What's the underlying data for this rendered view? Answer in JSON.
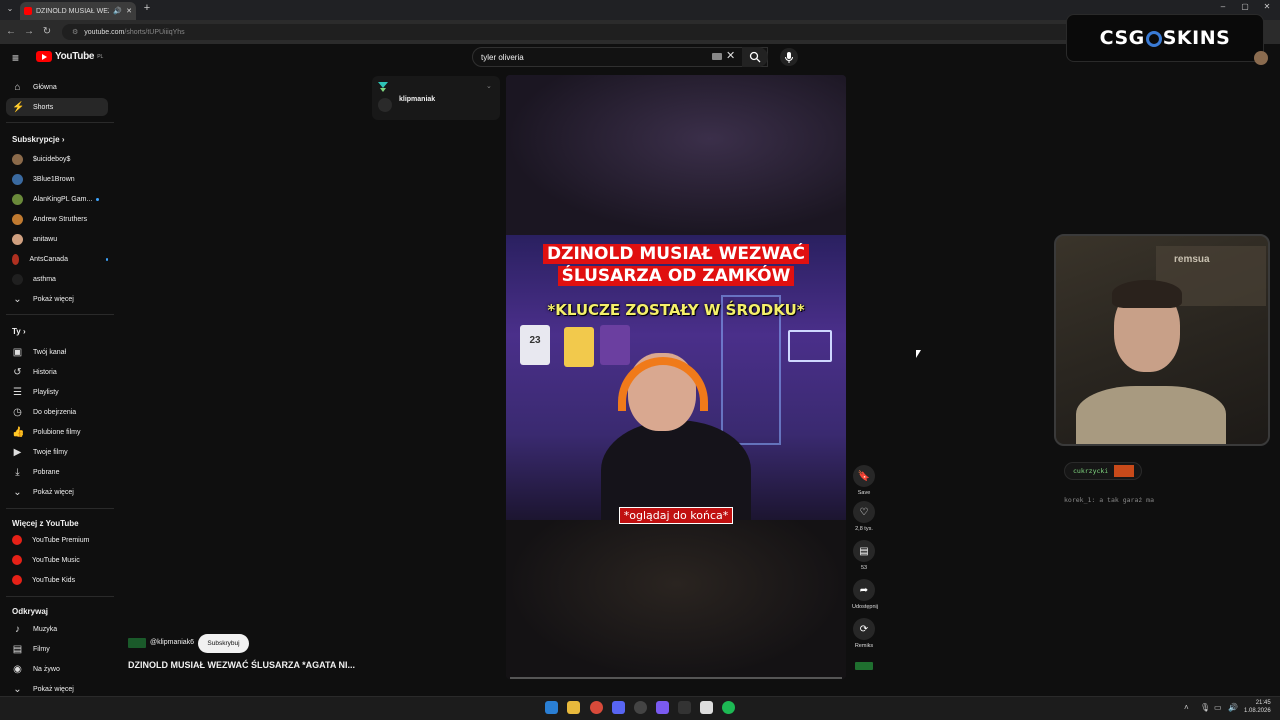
{
  "browser": {
    "tab_title": "DZINOLD MUSIAŁ WEZWA",
    "new_tab": "+",
    "url_host": "youtube.com",
    "url_path": "/shorts/tUPUiiiqYhs"
  },
  "header": {
    "logo_text": "YouTube",
    "region": "PL",
    "search_value": "tyler oliveria"
  },
  "overlay": {
    "brand_left": "CSG",
    "brand_right": "SKINS"
  },
  "sidebar": {
    "main": [
      {
        "label": "Główna",
        "icon": "home-icon"
      },
      {
        "label": "Shorts",
        "icon": "shorts-icon"
      }
    ],
    "subscriptions_title": "Subskrypcje",
    "subscriptions": [
      {
        "label": "$uicideboy$",
        "color": "#8b6a4a",
        "live": false
      },
      {
        "label": "3Blue1Brown",
        "color": "#3a6aa0",
        "live": false
      },
      {
        "label": "AlanKingPL Gam...",
        "color": "#6a8a3a",
        "live": true
      },
      {
        "label": "Andrew Struthers",
        "color": "#c07a30",
        "live": false
      },
      {
        "label": "anitawu",
        "color": "#d0a080",
        "live": false
      },
      {
        "label": "AntsCanada",
        "color": "#b03020",
        "live": true
      },
      {
        "label": "asthma",
        "color": "#202020",
        "live": false
      }
    ],
    "show_more": "Pokaż więcej",
    "you_title": "Ty",
    "you": [
      {
        "label": "Twój kanał",
        "icon": "channel-icon"
      },
      {
        "label": "Historia",
        "icon": "history-icon"
      },
      {
        "label": "Playlisty",
        "icon": "playlist-icon"
      },
      {
        "label": "Do obejrzenia",
        "icon": "watch-later-icon"
      },
      {
        "label": "Polubione filmy",
        "icon": "like-icon"
      },
      {
        "label": "Twoje filmy",
        "icon": "video-icon"
      },
      {
        "label": "Pobrane",
        "icon": "download-icon"
      },
      {
        "label": "Pokaż więcej",
        "icon": "chevron-down-icon"
      }
    ],
    "more_title": "Więcej z YouTube",
    "more": [
      {
        "label": "YouTube Premium"
      },
      {
        "label": "YouTube Music"
      },
      {
        "label": "YouTube Kids"
      }
    ],
    "explore_title": "Odkrywaj",
    "explore": [
      {
        "label": "Muzyka",
        "icon": "music-icon"
      },
      {
        "label": "Filmy",
        "icon": "film-icon"
      },
      {
        "label": "Na żywo",
        "icon": "live-icon"
      },
      {
        "label": "Pokaż więcej",
        "icon": "chevron-down-icon"
      }
    ]
  },
  "channel_card": {
    "name": "klipmaniak"
  },
  "video": {
    "caption_top": "DZINOLD MUSIAŁ WEZWAĆ ŚLUSARZA OD ZAMKÓW",
    "caption_mid": "*KLUCZE ZOSTAŁY W ŚRODKU*",
    "caption_bottom": "*oglądaj do końca*",
    "jersey_number": "23"
  },
  "actions": [
    {
      "label": "Save",
      "icon": "bookmark-icon"
    },
    {
      "label": "2,8 tys.",
      "icon": "heart-icon"
    },
    {
      "label": "53",
      "icon": "comment-icon"
    },
    {
      "label": "Udostępnij",
      "icon": "share-icon"
    },
    {
      "label": "Remiks",
      "icon": "remix-icon"
    }
  ],
  "meta": {
    "handle": "@klipmaniak6",
    "subscribe": "Subskrybuj",
    "title": "DZINOLD MUSIAŁ WEZWAĆ ŚLUSARZA *AGATA NI..."
  },
  "webcam": {
    "wall_text": "remsua"
  },
  "chat": {
    "line1_user": "cukrzycki",
    "line2": "korek_1: a tak garaż ma"
  },
  "taskbar": {
    "time": "21:45",
    "date": "1.08.2026"
  }
}
